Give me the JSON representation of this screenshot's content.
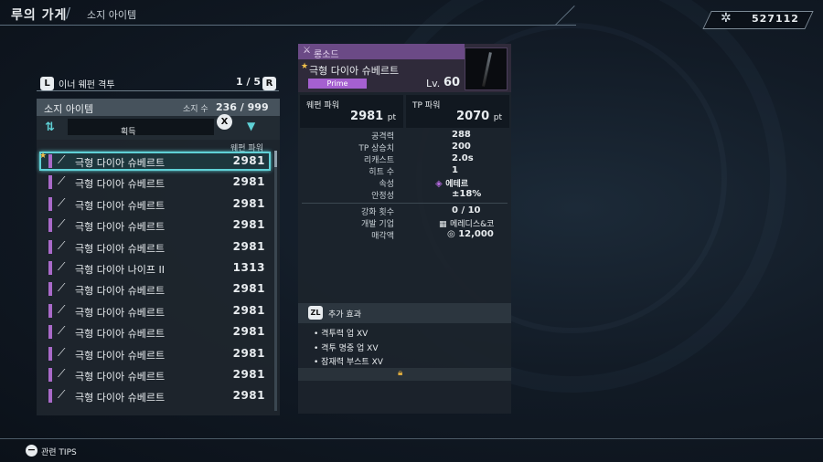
{
  "header": {
    "title": "루의 가게",
    "separator": "/",
    "subtitle": "소지 아이템",
    "currency_icon": "gear-icon",
    "currency": "527112"
  },
  "category": {
    "left_button": "L",
    "label": "이너 웨펀 격투",
    "page": "1 / 5",
    "right_button": "R"
  },
  "list": {
    "title": "소지 아이템",
    "count_label": "소지 수",
    "count": "236 / 999",
    "sort_label": "획득",
    "clear_button": "X",
    "column_header": "웨펀 파워",
    "rows": [
      {
        "name": "극형 다이아 슈베르트",
        "value": "2981",
        "icon": "sword-icon"
      },
      {
        "name": "극형 다이아 슈베르트",
        "value": "2981",
        "icon": "sword-icon"
      },
      {
        "name": "극형 다이아 슈베르트",
        "value": "2981",
        "icon": "sword-icon"
      },
      {
        "name": "극형 다이아 슈베르트",
        "value": "2981",
        "icon": "sword-icon"
      },
      {
        "name": "극형 다이아 슈베르트",
        "value": "2981",
        "icon": "sword-icon"
      },
      {
        "name": "극형 다이아 나이프 II",
        "value": "1313",
        "icon": "knife-icon"
      },
      {
        "name": "극형 다이아 슈베르트",
        "value": "2981",
        "icon": "sword-icon"
      },
      {
        "name": "극형 다이아 슈베르트",
        "value": "2981",
        "icon": "sword-icon"
      },
      {
        "name": "극형 다이아 슈베르트",
        "value": "2981",
        "icon": "sword-icon"
      },
      {
        "name": "극형 다이아 슈베르트",
        "value": "2981",
        "icon": "sword-icon"
      },
      {
        "name": "극형 다이아 슈베르트",
        "value": "2981",
        "icon": "sword-icon"
      },
      {
        "name": "극형 다이아 슈베르트",
        "value": "2981",
        "icon": "sword-icon"
      }
    ]
  },
  "detail": {
    "type": "롱소드",
    "name": "극형 다이아 슈베르트",
    "rarity": "Prime",
    "level_label": "Lv.",
    "level": "60",
    "weapon_power_label": "웨펀 파워",
    "weapon_power": "2981",
    "tp_power_label": "TP 파워",
    "tp_power": "2070",
    "unit": "pt",
    "stats": [
      {
        "label": "공격력",
        "value": "288"
      },
      {
        "label": "TP 상승치",
        "value": "200"
      },
      {
        "label": "리캐스트",
        "value": "2.0s"
      },
      {
        "label": "히트 수",
        "value": "1"
      },
      {
        "label": "속성",
        "value": "에테르"
      },
      {
        "label": "안정성",
        "value": "±18%"
      }
    ],
    "stats2": [
      {
        "label": "강화 횟수",
        "value": "0 / 10"
      },
      {
        "label": "개발 기업",
        "value": "메레디스&코"
      },
      {
        "label": "매각액",
        "value": "12,000"
      }
    ],
    "effects_button": "ZL",
    "effects_title": "추가 효과",
    "effects": [
      "격투력 업 XV",
      "격투 명중 업 XV",
      "잠재력 부스트 XV"
    ]
  },
  "footer": {
    "button": "−",
    "tips": "관련 TIPS"
  },
  "colors": {
    "accent": "#5fd1d6",
    "prime": "#a560d0",
    "star": "#f2c14a"
  }
}
